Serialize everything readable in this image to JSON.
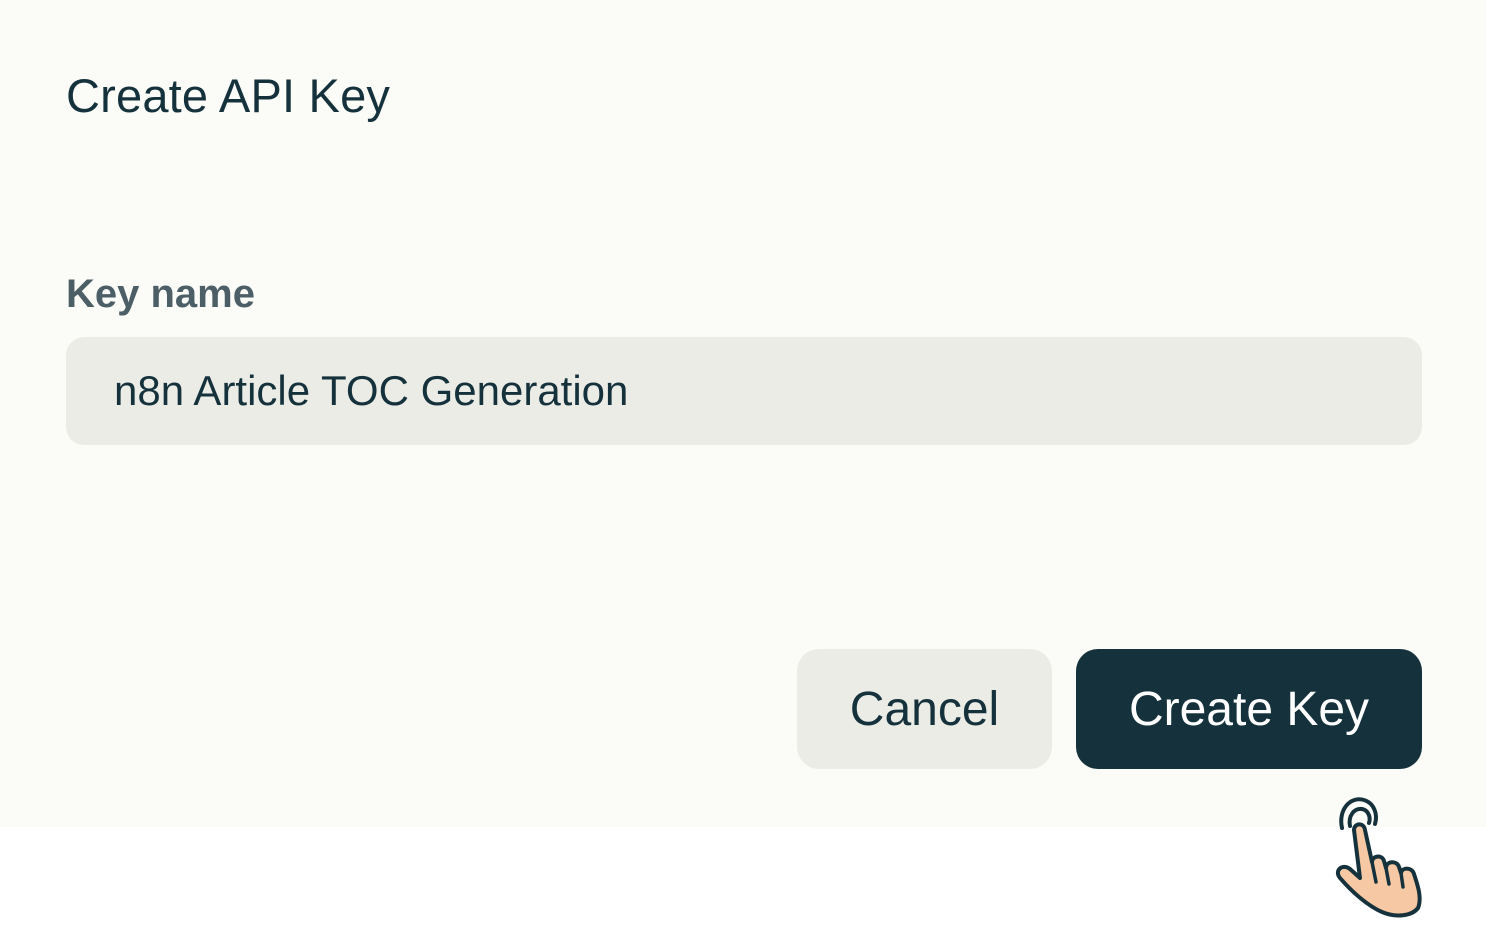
{
  "dialog": {
    "title": "Create API Key",
    "field": {
      "label": "Key name",
      "value": "n8n Article TOC Generation"
    },
    "buttons": {
      "cancel_label": "Cancel",
      "create_label": "Create Key"
    }
  },
  "colors": {
    "background": "#fbfbf8",
    "input_background": "#ecece7",
    "primary": "#15323c",
    "label": "#4d5f66"
  },
  "icons": {
    "cursor": "pointer-hand-icon"
  }
}
